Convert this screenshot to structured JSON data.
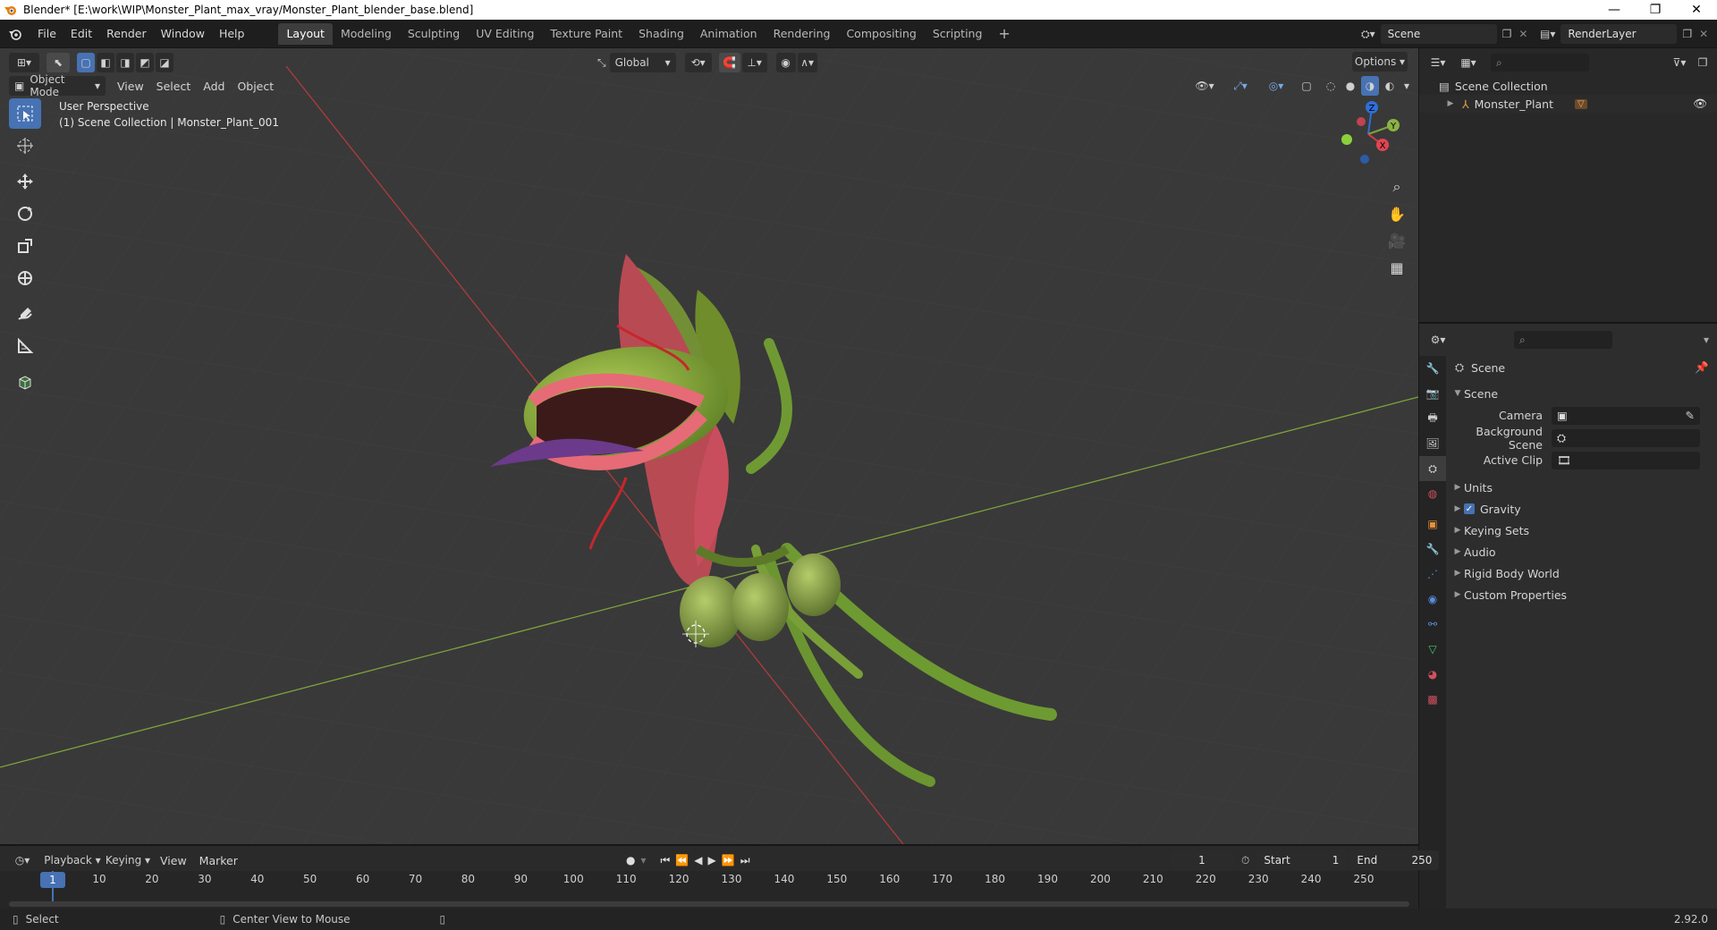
{
  "window": {
    "title": "Blender* [E:\\work\\WIP\\Monster_Plant_max_vray/Monster_Plant_blender_base.blend]"
  },
  "menubar": {
    "menus": [
      "File",
      "Edit",
      "Render",
      "Window",
      "Help"
    ],
    "workspaces": [
      "Layout",
      "Modeling",
      "Sculpting",
      "UV Editing",
      "Texture Paint",
      "Shading",
      "Animation",
      "Rendering",
      "Compositing",
      "Scripting"
    ],
    "active_workspace": "Layout",
    "add_tab": "+",
    "scene_name": "Scene",
    "view_layer": "RenderLayer"
  },
  "viewport": {
    "mode": "Object Mode",
    "menus": [
      "View",
      "Select",
      "Add",
      "Object"
    ],
    "transform_orientation": "Global",
    "options_label": "Options",
    "perspective_label": "User Perspective",
    "collection_label": "(1) Scene Collection | Monster_Plant_001",
    "gizmo": {
      "z": "Z",
      "y": "Y",
      "x": "X"
    },
    "colors": {
      "x_axis": "#b03b3b",
      "y_axis": "#7da33d",
      "bg": "#393939"
    }
  },
  "outliner": {
    "root": "Scene Collection",
    "items": [
      {
        "label": "Monster_Plant"
      }
    ]
  },
  "properties": {
    "context_title": "Scene",
    "section_title": "Scene",
    "fields": [
      {
        "label": "Camera"
      },
      {
        "label": "Background Scene"
      },
      {
        "label": "Active Clip"
      }
    ],
    "panels": [
      {
        "label": "Units",
        "checkbox": false
      },
      {
        "label": "Gravity",
        "checkbox": true
      },
      {
        "label": "Keying Sets",
        "checkbox": false
      },
      {
        "label": "Audio",
        "checkbox": false
      },
      {
        "label": "Rigid Body World",
        "checkbox": false
      },
      {
        "label": "Custom Properties",
        "checkbox": false
      }
    ]
  },
  "timeline": {
    "menus": [
      "Playback",
      "Keying",
      "View",
      "Marker"
    ],
    "current_frame": "1",
    "start_label": "Start",
    "start_value": "1",
    "end_label": "End",
    "end_value": "250",
    "ticks": [
      "1",
      "10",
      "20",
      "30",
      "40",
      "50",
      "60",
      "70",
      "80",
      "90",
      "100",
      "110",
      "120",
      "130",
      "140",
      "150",
      "160",
      "170",
      "180",
      "190",
      "200",
      "210",
      "220",
      "230",
      "240",
      "250"
    ]
  },
  "statusbar": {
    "left_hint": "Select",
    "mid_hint": "Center View to Mouse",
    "version": "2.92.0"
  }
}
